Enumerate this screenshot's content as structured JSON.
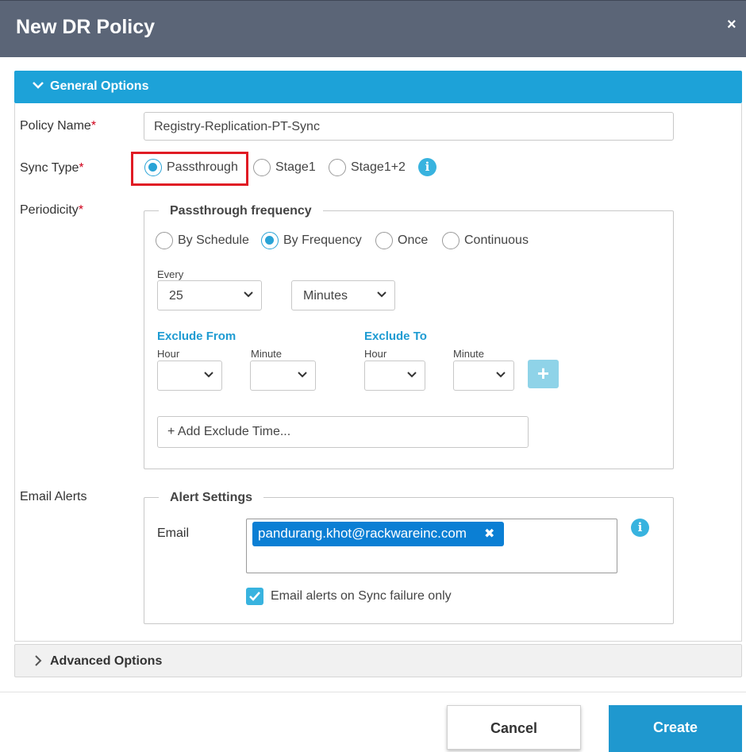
{
  "dialog": {
    "title": "New DR Policy",
    "close_glyph": "×"
  },
  "general": {
    "section_title": "General Options",
    "policy_name": {
      "label": "Policy Name",
      "value": "Registry-Replication-PT-Sync"
    },
    "sync_type": {
      "label": "Sync Type",
      "options": [
        "Passthrough",
        "Stage1",
        "Stage1+2"
      ],
      "selected": "Passthrough"
    },
    "periodicity": {
      "label": "Periodicity",
      "legend": "Passthrough frequency",
      "options": [
        "By Schedule",
        "By Frequency",
        "Once",
        "Continuous"
      ],
      "selected": "By Frequency",
      "every_label": "Every",
      "every_value": "25",
      "unit_value": "Minutes",
      "exclude_from_label": "Exclude From",
      "exclude_to_label": "Exclude To",
      "hour_label": "Hour",
      "minute_label": "Minute",
      "add_button": "+",
      "add_exclude_placeholder": "+ Add Exclude Time..."
    },
    "email_alerts": {
      "label": "Email Alerts",
      "legend": "Alert Settings",
      "email_label": "Email",
      "email_chip": "pandurang.khot@rackwareinc.com",
      "chip_remove": "✖",
      "failure_only_label": "Email alerts on Sync failure only",
      "failure_only_checked": true
    }
  },
  "advanced": {
    "section_title": "Advanced Options"
  },
  "footer": {
    "cancel": "Cancel",
    "create": "Create"
  },
  "icons": {
    "info": "i",
    "required_marker": "*"
  },
  "colors": {
    "header": "#5b6577",
    "accent": "#1da2d8",
    "highlight": "#e01b24",
    "chip": "#0b7fd4"
  }
}
